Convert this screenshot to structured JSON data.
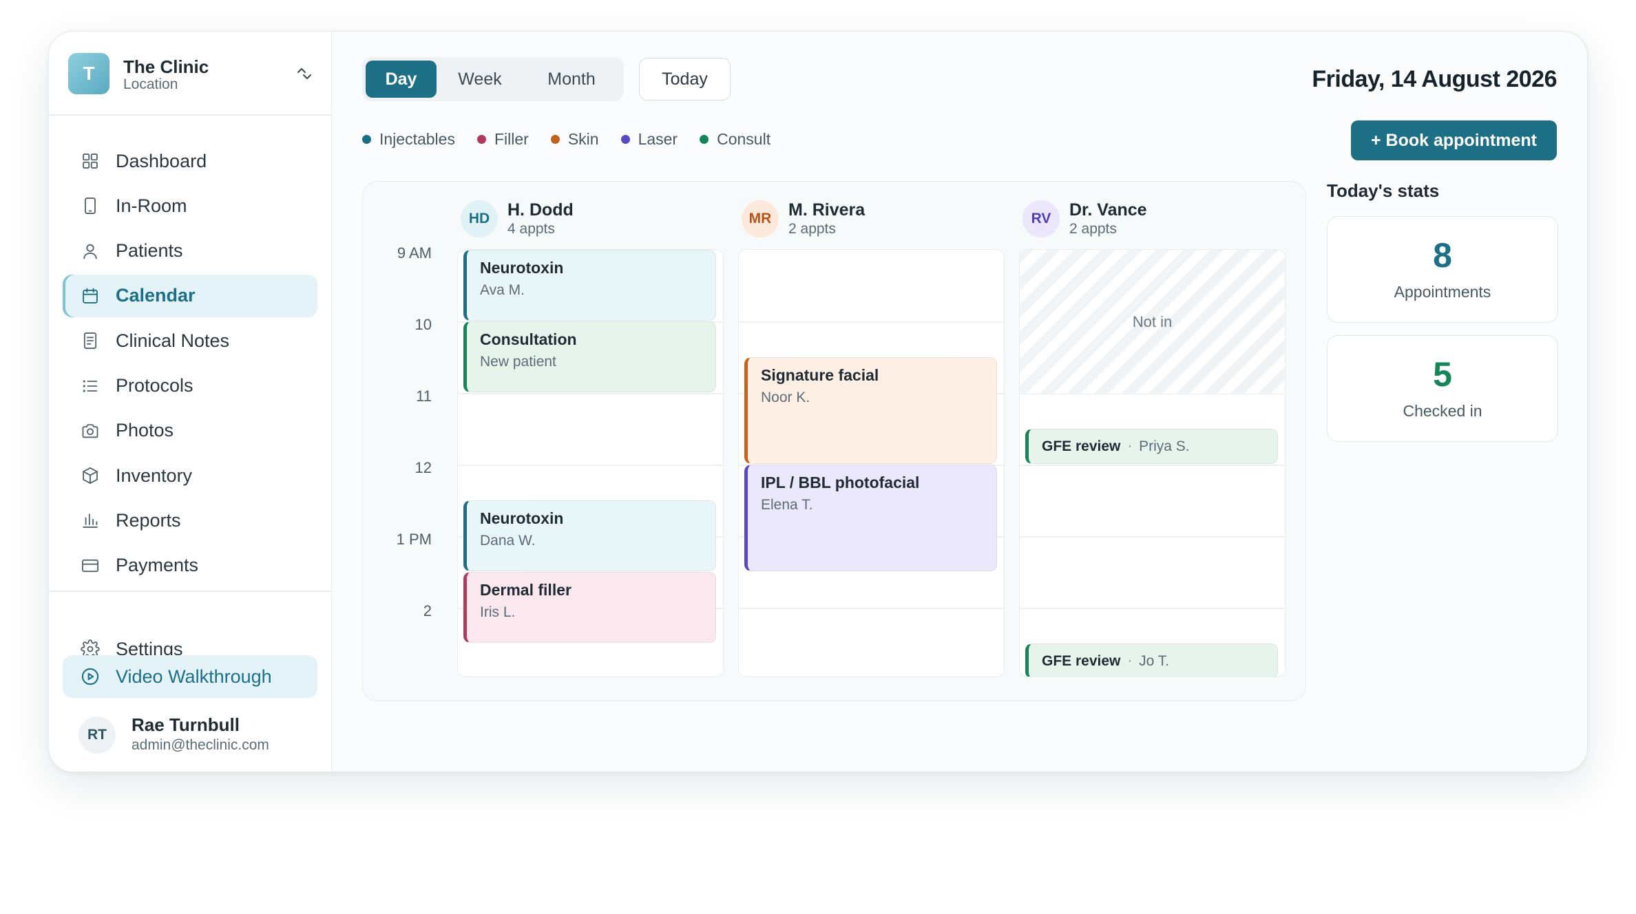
{
  "clinic": {
    "initial": "T",
    "name": "The Clinic",
    "subtitle": "Location"
  },
  "nav": [
    {
      "key": "dashboard",
      "label": "Dashboard",
      "icon": "grid-icon"
    },
    {
      "key": "in-room",
      "label": "In-Room",
      "icon": "tablet-icon"
    },
    {
      "key": "patients",
      "label": "Patients",
      "icon": "user-icon"
    },
    {
      "key": "calendar",
      "label": "Calendar",
      "icon": "calendar-icon",
      "active": true
    },
    {
      "key": "clinical-notes",
      "label": "Clinical Notes",
      "icon": "document-icon"
    },
    {
      "key": "protocols",
      "label": "Protocols",
      "icon": "list-icon"
    },
    {
      "key": "photos",
      "label": "Photos",
      "icon": "camera-icon"
    },
    {
      "key": "inventory",
      "label": "Inventory",
      "icon": "box-icon"
    },
    {
      "key": "reports",
      "label": "Reports",
      "icon": "bar-chart-icon"
    },
    {
      "key": "payments",
      "label": "Payments",
      "icon": "credit-card-icon"
    }
  ],
  "footer_nav": {
    "settings": {
      "label": "Settings",
      "icon": "gear-icon"
    },
    "walkthrough": {
      "label": "Video Walkthrough",
      "icon": "play-circle-icon"
    }
  },
  "user": {
    "initials": "RT",
    "name": "Rae Turnbull",
    "email": "admin@theclinic.com"
  },
  "views": [
    {
      "label": "Day",
      "active": true
    },
    {
      "label": "Week",
      "active": false
    },
    {
      "label": "Month",
      "active": false
    }
  ],
  "today_label": "Today",
  "date_title": "Friday, 14 August 2026",
  "book_button": "+ Book appointment",
  "legend": [
    {
      "label": "Injectables",
      "color": "#1d6f86"
    },
    {
      "label": "Filler",
      "color": "#b03a5b"
    },
    {
      "label": "Skin",
      "color": "#c4621d"
    },
    {
      "label": "Laser",
      "color": "#5b47c2"
    },
    {
      "label": "Consult",
      "color": "#16855a"
    }
  ],
  "time_labels": [
    "9 AM",
    "10",
    "11",
    "12",
    "1 PM",
    "2"
  ],
  "providers": [
    {
      "initials": "HD",
      "name": "H. Dodd",
      "count": "4 appts",
      "avatar_bg": "#e1f2f6",
      "avatar_fg": "#1d6f86",
      "appointments": [
        {
          "title": "Neurotoxin",
          "patient": "Ava M.",
          "type": "injectables",
          "start": 9,
          "end": 10
        },
        {
          "title": "Consultation",
          "patient": "New patient",
          "type": "consult",
          "start": 10,
          "end": 11
        },
        {
          "title": "Neurotoxin",
          "patient": "Dana W.",
          "type": "injectables",
          "start": 12.5,
          "end": 13.5
        },
        {
          "title": "Dermal filler",
          "patient": "Iris L.",
          "type": "filler",
          "start": 13.5,
          "end": 14.5
        }
      ]
    },
    {
      "initials": "MR",
      "name": "M. Rivera",
      "count": "2 appts",
      "avatar_bg": "#fde9dc",
      "avatar_fg": "#b4561a",
      "appointments": [
        {
          "title": "Signature facial",
          "patient": "Noor K.",
          "type": "skin",
          "start": 10.5,
          "end": 12
        },
        {
          "title": "IPL / BBL photofacial",
          "patient": "Elena T.",
          "type": "laser",
          "start": 12,
          "end": 13.5
        }
      ]
    },
    {
      "initials": "RV",
      "name": "Dr. Vance",
      "count": "2 appts",
      "avatar_bg": "#ebe6fb",
      "avatar_fg": "#4f3fb0",
      "not_in_label": "Not in",
      "appointments": [
        {
          "title": "GFE review",
          "patient": "Priya S.",
          "type": "consult",
          "start": 11.5,
          "end": 12,
          "inline": true
        },
        {
          "title": "GFE review",
          "patient": "Jo T.",
          "type": "consult",
          "start": 14.5,
          "end": 15,
          "inline": true
        }
      ]
    }
  ],
  "type_styles": {
    "injectables": {
      "bg": "#e8f6fa",
      "border": "#1d6f86"
    },
    "consult": {
      "bg": "#e6f4ec",
      "border": "#16855a"
    },
    "filler": {
      "bg": "#fbe8ee",
      "border": "#b03a5b"
    },
    "skin": {
      "bg": "#fdefe4",
      "border": "#c4621d"
    },
    "laser": {
      "bg": "#ece8fb",
      "border": "#5b47c2"
    }
  },
  "stats": {
    "title": "Today's stats",
    "items": [
      {
        "value": "8",
        "label": "Appointments",
        "color": "#1d6f86"
      },
      {
        "value": "5",
        "label": "Checked in",
        "color": "#16855a"
      }
    ]
  }
}
